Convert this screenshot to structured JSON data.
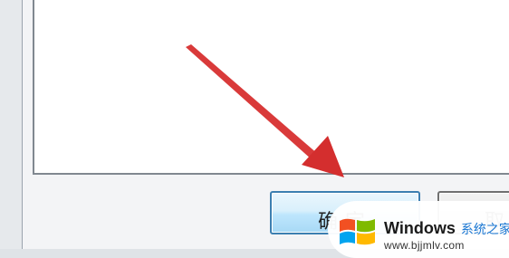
{
  "dialog": {
    "ok_label": "确定",
    "cancel_label": "取"
  },
  "annotation": {
    "arrow_color": "#d93a3a",
    "arrow_target": "ok-button"
  },
  "watermark": {
    "brand": "Windows",
    "tagline": "系统之家",
    "url": "www.bjjmlv.com",
    "logo_colors": [
      "#f25022",
      "#7fba00",
      "#00a4ef",
      "#ffb900"
    ]
  },
  "colors": {
    "ok_border": "#3c7fb1",
    "cancel_border": "#707070",
    "panel_border": "#808890"
  }
}
